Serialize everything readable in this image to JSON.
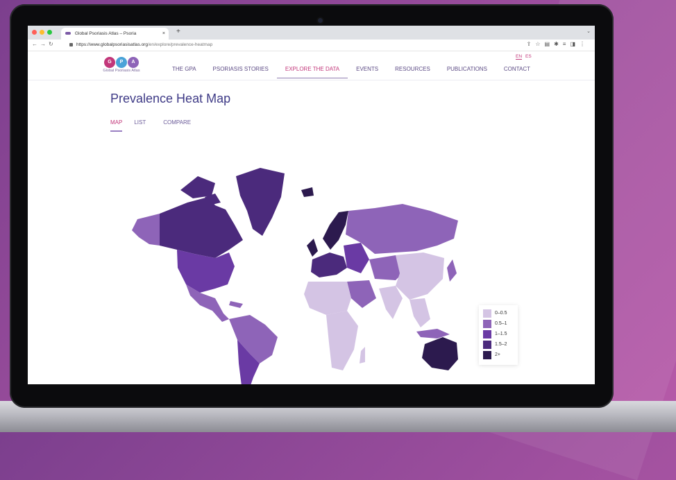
{
  "browser": {
    "tab_title": "Global Psoriasis Atlas – Psoria",
    "url_host": "https://www.globalpsoriasisatlas.org",
    "url_path": "/en/explore/prevalence-heatmap"
  },
  "site": {
    "logo_letters": [
      "G",
      "P",
      "A"
    ],
    "logo_text": "Global Psoriasis Atlas",
    "lang": {
      "en": "EN",
      "es": "ES"
    },
    "nav": [
      "THE GPA",
      "PSORIASIS STORIES",
      "EXPLORE THE DATA",
      "EVENTS",
      "RESOURCES",
      "PUBLICATIONS",
      "CONTACT"
    ],
    "active_nav": "EXPLORE THE DATA",
    "page_title": "Prevalence Heat Map",
    "subtabs": [
      "MAP",
      "LIST",
      "COMPARE"
    ],
    "active_subtab": "MAP"
  },
  "legend": [
    {
      "label": "0–0.5",
      "color": "#d4c4e4"
    },
    {
      "label": "0.5–1",
      "color": "#8e64b8"
    },
    {
      "label": "1–1.5",
      "color": "#6a3aa4"
    },
    {
      "label": "1.5–2",
      "color": "#4b2a7c"
    },
    {
      "label": "2+",
      "color": "#2c1a4e"
    }
  ],
  "colors": {
    "accent": "#c2377a",
    "title": "#3e3a86",
    "nav": "#5b4a84"
  }
}
